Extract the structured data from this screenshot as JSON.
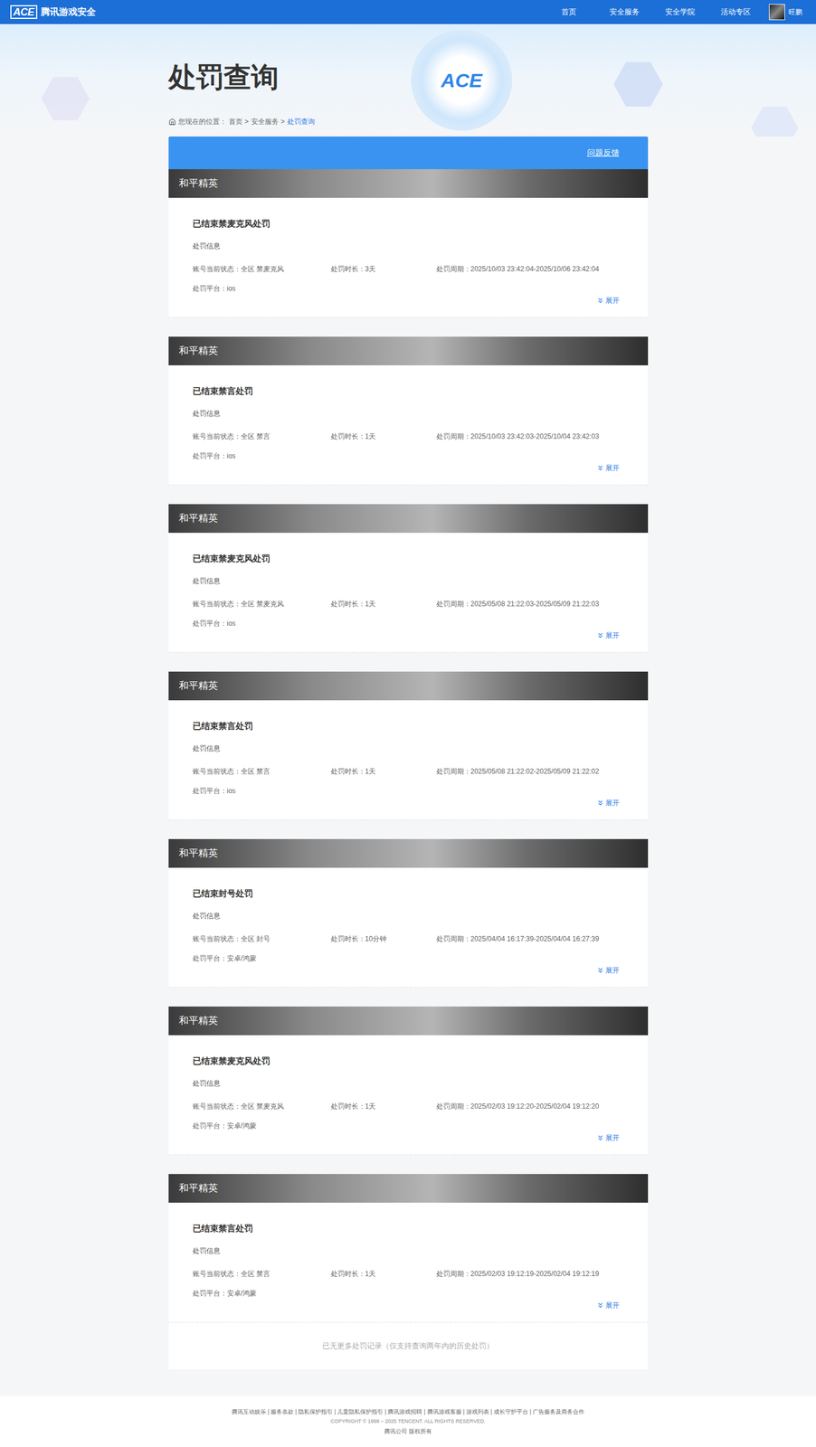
{
  "nav": {
    "logo_mark": "ACE",
    "logo_text": "腾讯游戏安全",
    "items": [
      {
        "label": "首页",
        "selected": false
      },
      {
        "label": "安全服务",
        "selected": false
      },
      {
        "label": "安全学院",
        "selected": false
      },
      {
        "label": "活动专区",
        "selected": false
      }
    ],
    "user": "旺鹏"
  },
  "header": {
    "title": "处罚查询",
    "emblem": "ACE"
  },
  "breadcrumb": {
    "prefix": "您现在的位置：",
    "separator": ">",
    "items": [
      {
        "label": "首页",
        "selected": false
      },
      {
        "label": "安全服务",
        "selected": false
      },
      {
        "label": "处罚查询",
        "selected": true
      }
    ]
  },
  "toolbar": {
    "feedback": "问题反馈"
  },
  "records": [
    {
      "game": "和平精英",
      "title": "已结束禁麦克风处罚",
      "info_label": "处罚信息",
      "status": "账号当前状态：全区 禁麦克风",
      "duration": "处罚时长：3天",
      "period": "处罚周期：2025/10/03 23:42:04-2025/10/06 23:42:04",
      "platform": "处罚平台：ios",
      "expand": "展开",
      "expanded": false
    },
    {
      "game": "和平精英",
      "title": "已结束禁言处罚",
      "info_label": "处罚信息",
      "status": "账号当前状态：全区 禁言",
      "duration": "处罚时长：1天",
      "period": "处罚周期：2025/10/03 23:42:03-2025/10/04 23:42:03",
      "platform": "处罚平台：ios",
      "expand": "展开",
      "expanded": false
    },
    {
      "game": "和平精英",
      "title": "已结束禁麦克风处罚",
      "info_label": "处罚信息",
      "status": "账号当前状态：全区 禁麦克风",
      "duration": "处罚时长：1天",
      "period": "处罚周期：2025/05/08 21:22:03-2025/05/09 21:22:03",
      "platform": "处罚平台：ios",
      "expand": "展开",
      "expanded": false
    },
    {
      "game": "和平精英",
      "title": "已结束禁言处罚",
      "info_label": "处罚信息",
      "status": "账号当前状态：全区 禁言",
      "duration": "处罚时长：1天",
      "period": "处罚周期：2025/05/08 21:22:02-2025/05/09 21:22:02",
      "platform": "处罚平台：ios",
      "expand": "展开",
      "expanded": false
    },
    {
      "game": "和平精英",
      "title": "已结束封号处罚",
      "info_label": "处罚信息",
      "status": "账号当前状态：全区 封号",
      "duration": "处罚时长：10分钟",
      "period": "处罚周期：2025/04/04 16:17:39-2025/04/04 16:27:39",
      "platform": "处罚平台：安卓/鸿蒙",
      "expand": "展开",
      "expanded": false
    },
    {
      "game": "和平精英",
      "title": "已结束禁麦克风处罚",
      "info_label": "处罚信息",
      "status": "账号当前状态：全区 禁麦克风",
      "duration": "处罚时长：1天",
      "period": "处罚周期：2025/02/03 19:12:20-2025/02/04 19:12:20",
      "platform": "处罚平台：安卓/鸿蒙",
      "expand": "展开",
      "expanded": false
    },
    {
      "game": "和平精英",
      "title": "已结束禁言处罚",
      "info_label": "处罚信息",
      "status": "账号当前状态：全区 禁言",
      "duration": "处罚时长：1天",
      "period": "处罚周期：2025/02/03 19:12:19-2025/02/04 19:12:19",
      "platform": "处罚平台：安卓/鸿蒙",
      "expand": "展开",
      "expanded": false
    }
  ],
  "end_note": "已无更多处罚记录（仅支持查询两年内的历史处罚）",
  "footer": {
    "links": "腾讯互动娱乐 | 服务条款 | 隐私保护指引 | 儿童隐私保护指引 | 腾讯游戏招聘 | 腾讯游戏客服 | 游戏列表 | 成长守护平台 | 广告服务及商务合作",
    "copyright": "COPYRIGHT © 1998 – 2025 TENCENT. ALL RIGHTS RESERVED.",
    "owner": "腾讯公司 版权所有"
  }
}
